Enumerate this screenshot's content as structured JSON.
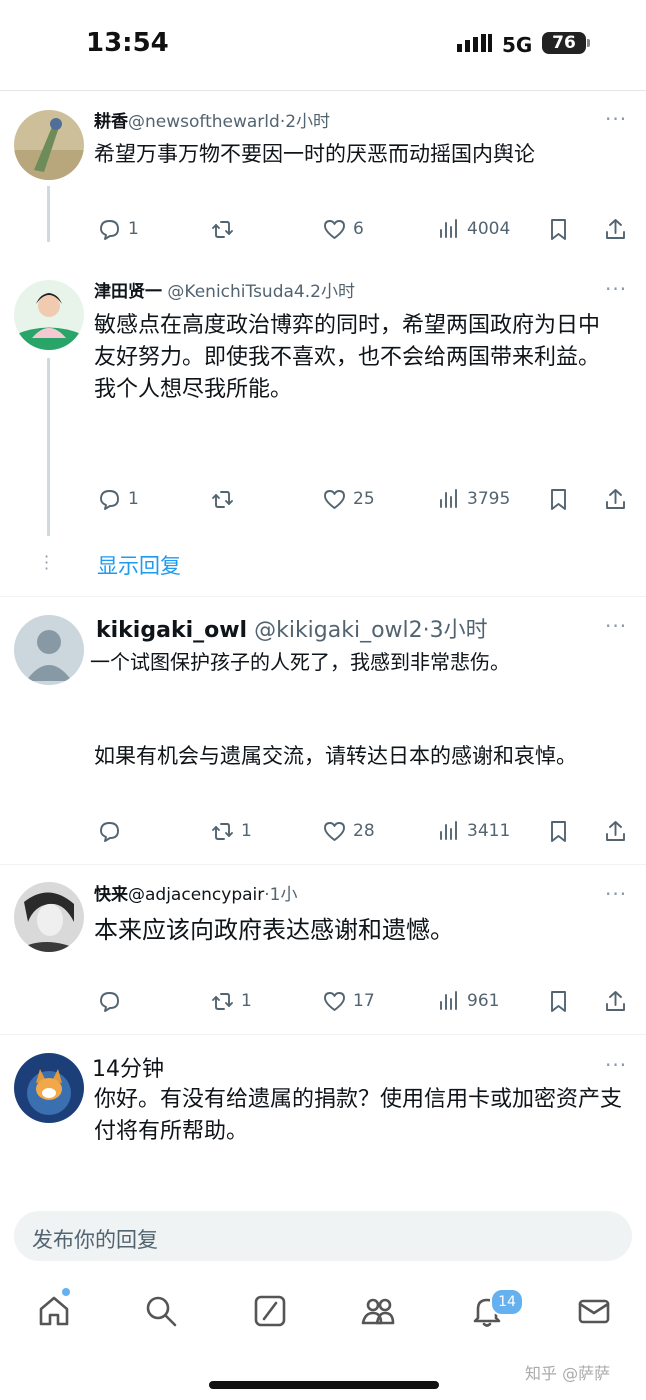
{
  "status_bar": {
    "time": "13:54",
    "network": "5G",
    "battery": "76"
  },
  "tweets": [
    {
      "name": "耕香",
      "handle": "@newsofthewarld",
      "time": "·2小时",
      "text": "希望万事万物不要因一时的厌恶而动摇国内舆论",
      "replies": "1",
      "retweets": "",
      "likes": "6",
      "views": "4004"
    },
    {
      "name": "津田贤一",
      "handle": " @KenichiTsuda4.",
      "time": "2小时",
      "text": "敏感点在高度政治博弈的同时，希望两国政府为日中友好努力。即使我不喜欢，也不会给两国带来利益。我个人想尽我所能。",
      "replies": "1",
      "retweets": "",
      "likes": "25",
      "views": "3795"
    },
    {
      "name": "kikigaki_owl",
      "handle": " @kikigaki_owl2",
      "time": "·3小时",
      "text": "一个试图保护孩子的人死了，我感到非常悲伤。",
      "text2": "如果有机会与遗属交流，请转达日本的感谢和哀悼。",
      "replies": "",
      "retweets": "1",
      "likes": "28",
      "views": "3411"
    },
    {
      "name": "快来",
      "handle": "@adjacencypair",
      "time": "·1小",
      "text": "本来应该向政府表达感谢和遗憾。",
      "replies": "",
      "retweets": "1",
      "likes": "17",
      "views": "961"
    },
    {
      "name": "",
      "handle": "",
      "time": "14分钟",
      "text": "你好。有没有给遗属的捐款？使用信用卡或加密资产支付将有所帮助。"
    }
  ],
  "more_label": "···",
  "show_replies": "显示回复",
  "reply_placeholder": "发布你的回复",
  "nav": {
    "notifications_badge": "14"
  },
  "watermark": "知乎 @萨萨",
  "icons": {
    "reply": "reply-icon",
    "retweet": "retweet-icon",
    "like": "heart-icon",
    "views": "views-icon",
    "bookmark": "bookmark-icon",
    "share": "share-icon"
  }
}
